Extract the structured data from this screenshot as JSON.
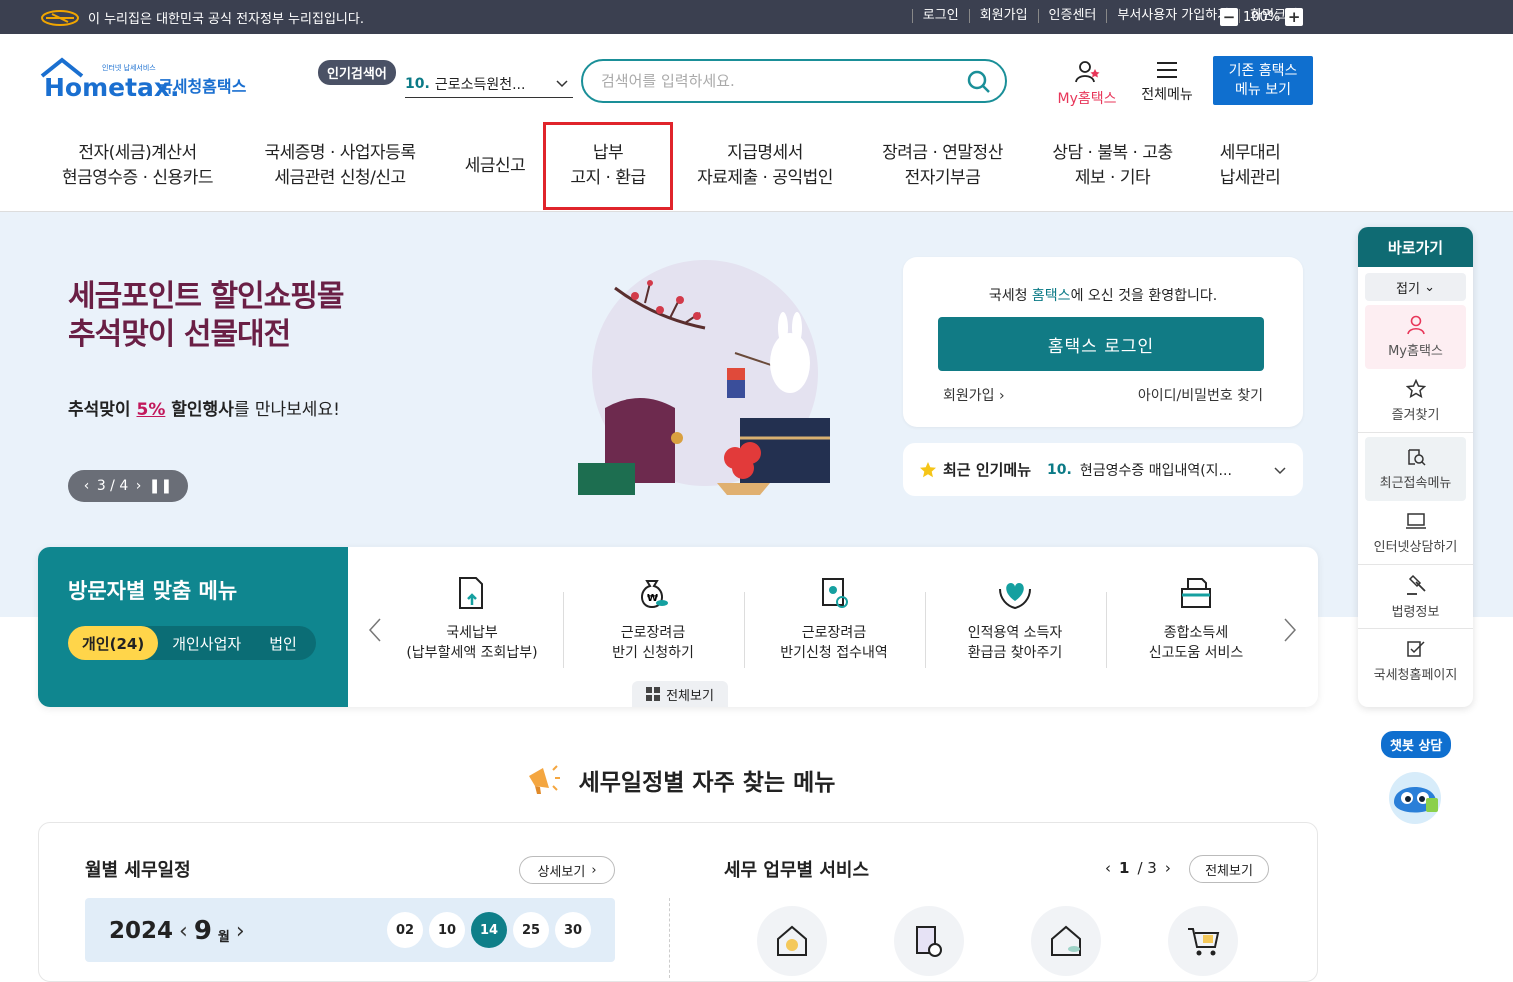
{
  "topbar": {
    "gov_notice": "이 누리집은 대한민국 공식 전자정부 누리집입니다.",
    "links": [
      "로그인",
      "회원가입",
      "인증센터",
      "부서사용자 가입하기",
      "화면크기"
    ],
    "zoom_minus": "−",
    "zoom_level": "100%",
    "zoom_plus": "+"
  },
  "header": {
    "logo_tagline": "인터넷 납세서비스",
    "logo_text": "Hometax.",
    "logo_kr": "국세청홈택스",
    "hot_badge": "인기검색어",
    "hot_rank": "10.",
    "hot_term": "근로소득원천...",
    "search_placeholder": "검색어를 입력하세요.",
    "my_hometax": "My홈택스",
    "all_menu": "전체메뉴",
    "old_menu_line1": "기존 홈택스",
    "old_menu_line2": "메뉴 보기"
  },
  "nav": [
    {
      "line1": "전자(세금)계산서",
      "line2": "현금영수증 · 신용카드"
    },
    {
      "line1": "국세증명 · 사업자등록",
      "line2": "세금관련 신청/신고"
    },
    {
      "line1": "세금신고",
      "line2": ""
    },
    {
      "line1": "납부",
      "line2": "고지 · 환급"
    },
    {
      "line1": "지급명세서",
      "line2": "자료제출 · 공익법인"
    },
    {
      "line1": "장려금 · 연말정산",
      "line2": "전자기부금"
    },
    {
      "line1": "상담 · 불복 · 고충",
      "line2": "제보 · 기타"
    },
    {
      "line1": "세무대리",
      "line2": "납세관리"
    }
  ],
  "hero": {
    "title_line1": "세금포인트 할인쇼핑몰",
    "title_line2": "추석맞이 선물대전",
    "sub_pre": "추석맞이 ",
    "sub_highlight": "5%",
    "sub_mid": " 할인행사",
    "sub_post": "를 만나보세요!",
    "pager": "3 / 4"
  },
  "login": {
    "welcome_pre": "국세청 ",
    "welcome_brand": "홈택스",
    "welcome_post": "에 오신 것을 환영합니다.",
    "login_button": "홈택스 로그인",
    "join": "회원가입",
    "find": "아이디/비밀번호 찾기"
  },
  "popular": {
    "label": "최근 인기메뉴",
    "rank": "10.",
    "text": "현금영수증 매입내역(지..."
  },
  "visitor": {
    "title": "방문자별 맞춤 메뉴",
    "tabs": [
      "개인(24)",
      "개인사업자",
      "법인"
    ],
    "items": [
      {
        "line1": "국세납부",
        "line2": "(납부할세액 조회납부)"
      },
      {
        "line1": "근로장려금",
        "line2": "반기 신청하기"
      },
      {
        "line1": "근로장려금",
        "line2": "반기신청 접수내역"
      },
      {
        "line1": "인적용역 소득자",
        "line2": "환급금 찾아주기"
      },
      {
        "line1": "종합소득세",
        "line2": "신고도움 서비스"
      }
    ],
    "view_all": "전체보기"
  },
  "quick": {
    "title": "바로가기",
    "fold": "접기",
    "items": [
      "My홈택스",
      "즐겨찾기",
      "최근접속메뉴",
      "인터넷상담하기",
      "법령정보",
      "국세청홈페이지"
    ],
    "chat_label": "챗봇 상담"
  },
  "schedule": {
    "section_title": "세무일정별 자주 찾는 메뉴",
    "monthly_title": "월별 세무일정",
    "detail_button": "상세보기",
    "year": "2024",
    "month": "9",
    "month_unit": "월",
    "days": [
      "02",
      "10",
      "14",
      "25",
      "30"
    ],
    "selected_day": "14",
    "service_title": "세무 업무별 서비스",
    "page_current": "1",
    "page_total": "/ 3",
    "view_all": "전체보기"
  },
  "colors": {
    "teal": "#0f868f",
    "accent_pink": "#e8375a",
    "blue": "#0f6fcf",
    "hero_bg": "#eaf2fa",
    "hero_title": "#6a1f45"
  }
}
